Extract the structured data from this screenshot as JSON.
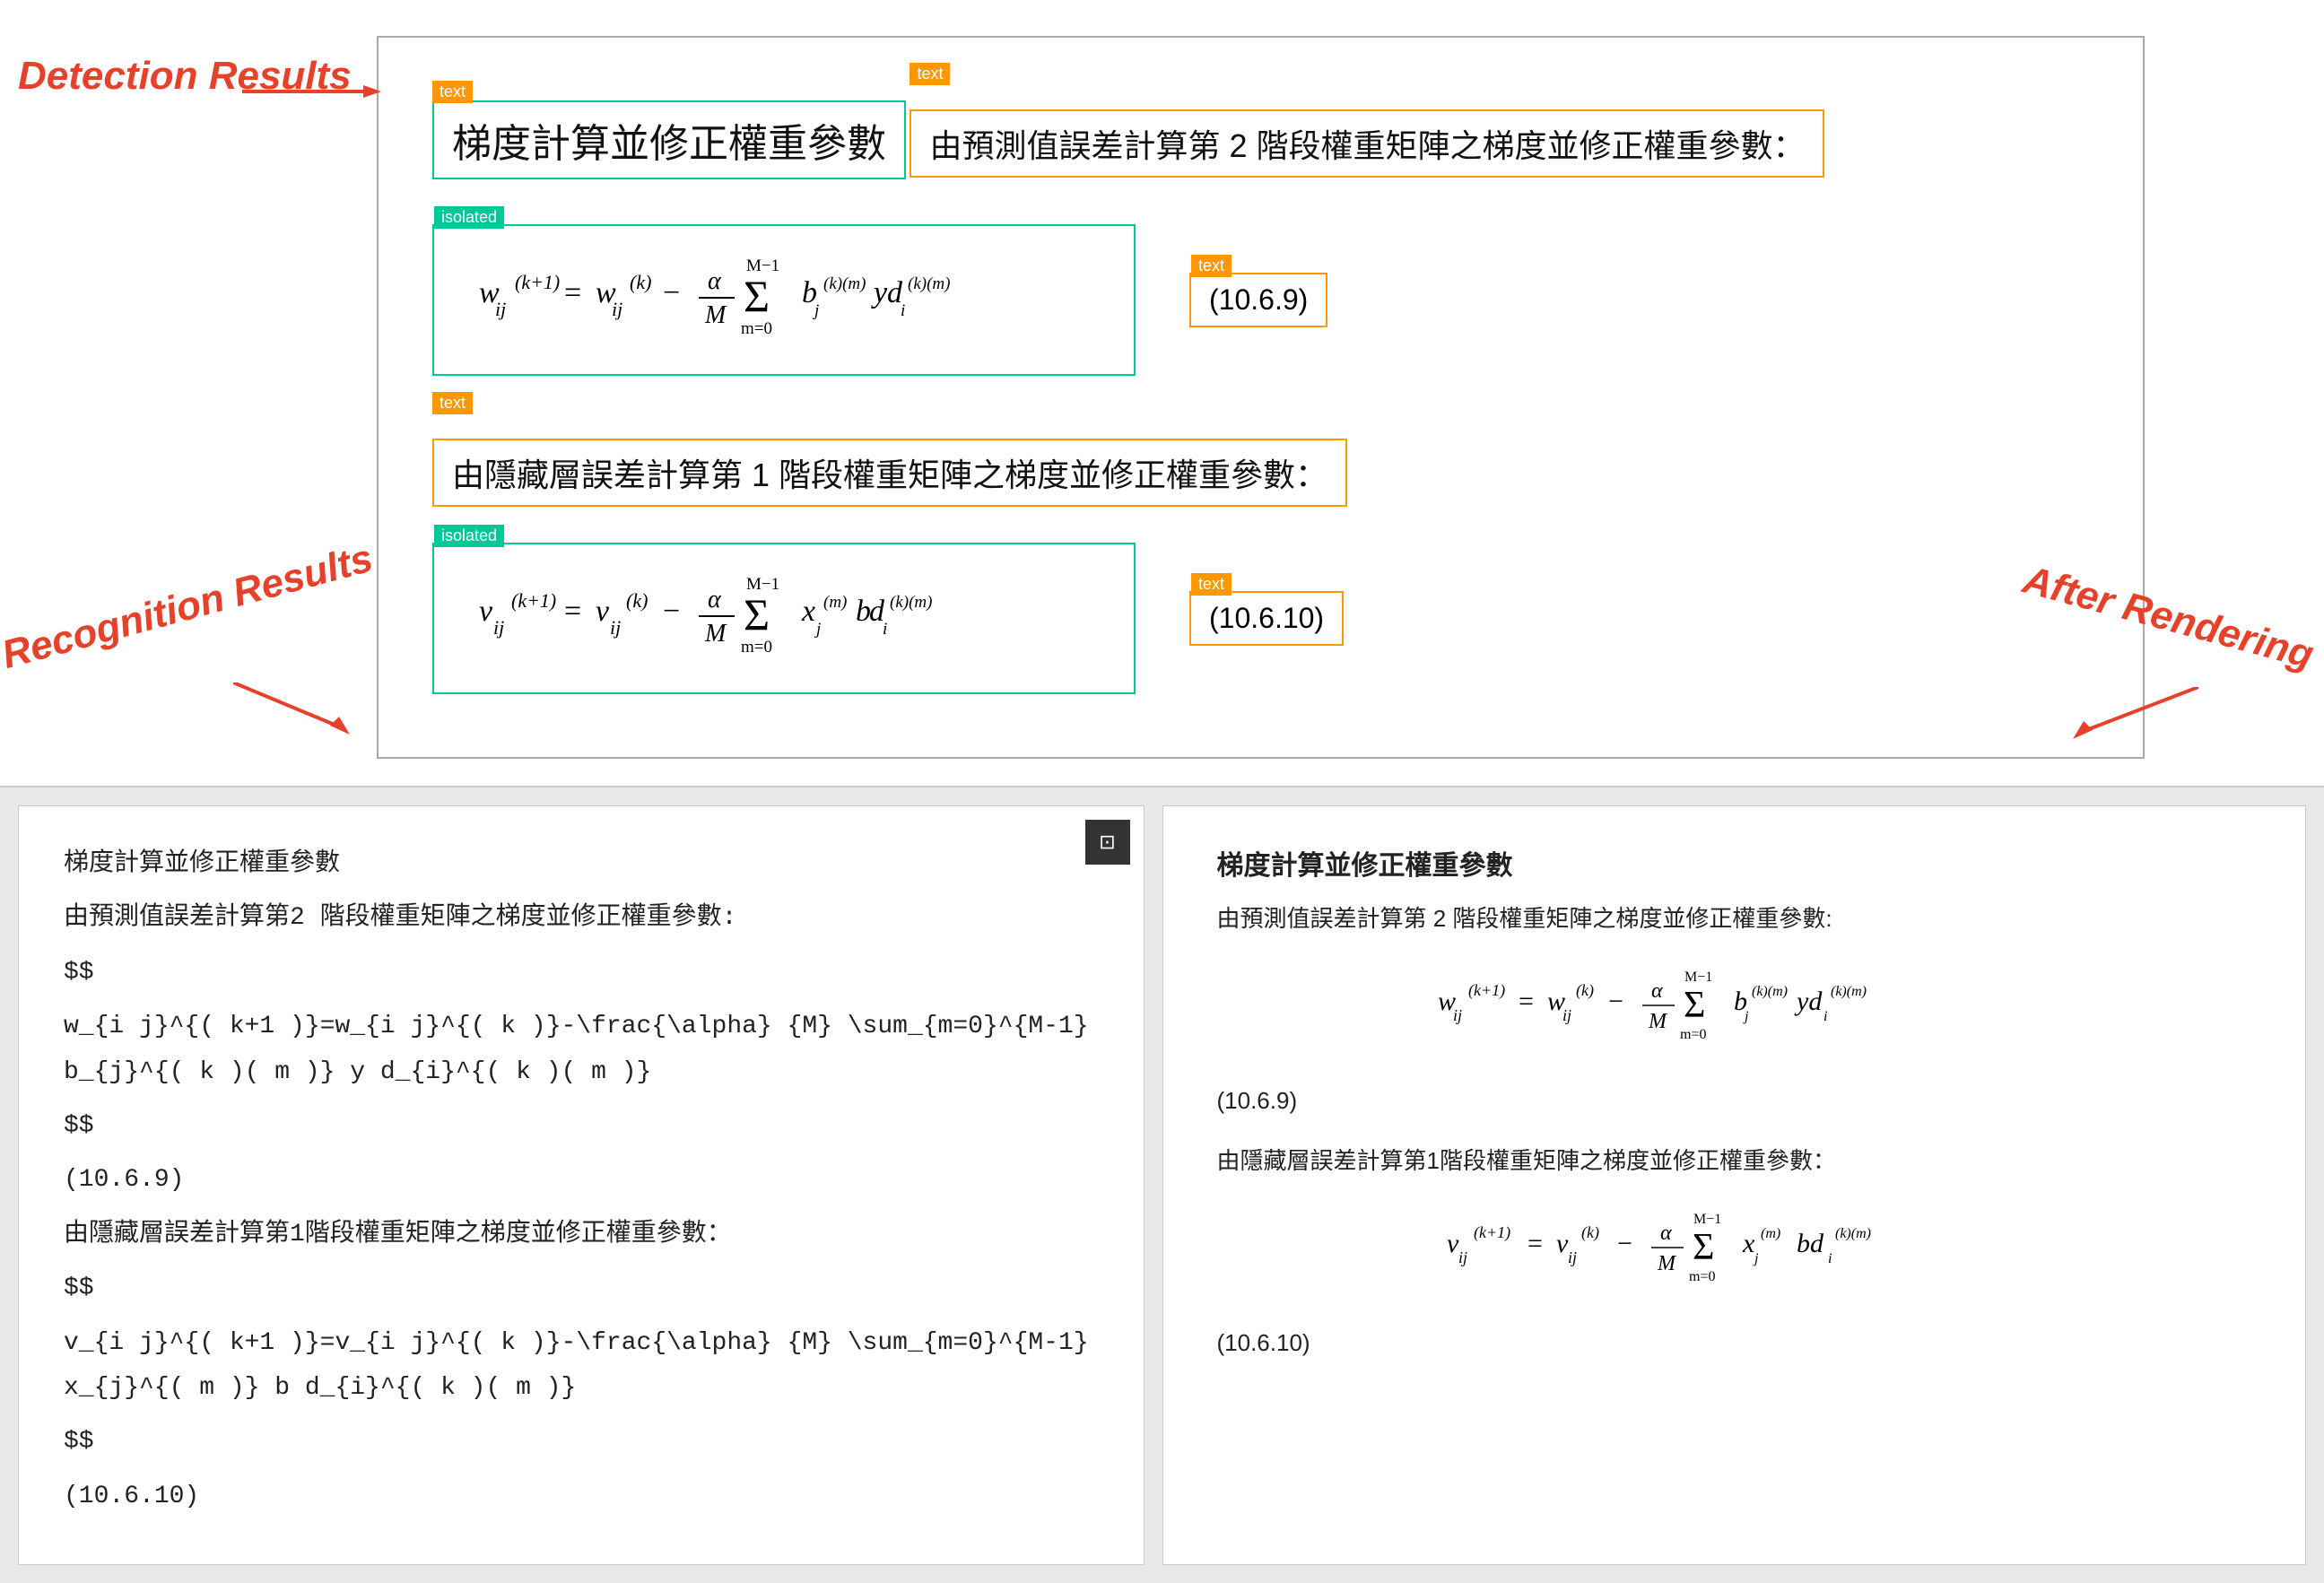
{
  "labels": {
    "detection_results": "Detection Results",
    "recognition_results": "Recognition Results",
    "after_rendering": "After Rendering"
  },
  "content": {
    "title": "梯度計算並修正權重參數",
    "title_tag": "text",
    "section1_tag": "text",
    "section1_text": "由預測值誤差計算第 2 階段權重矩陣之梯度並修正權重參數：",
    "formula1_tag": "isolated",
    "formula1_number": "(10.6.9)",
    "formula1_number_tag": "text",
    "section2_tag": "text",
    "section2_text": "由隱藏層誤差計算第 1 階段權重矩陣之梯度並修正權重參數：",
    "formula2_tag": "isolated",
    "formula2_number": "(10.6.10)",
    "formula2_number_tag": "text"
  },
  "bottom_left": {
    "copy_icon": "⊡",
    "line1": "梯度計算並修正權重參數",
    "line2": "由預測值誤差計算第2 階段權重矩陣之梯度並修正權重參數:",
    "line3": "$$",
    "line4": "w_{i j}^{( k+1 )}=w_{i j}^{( k )}-\\frac{\\alpha} {M} \\sum_{m=0}^{M-1} b_{j}^{( k )( m )} y d_{i}^{( k )( m )}",
    "line5": "$$",
    "line6": "(10.6.9)",
    "line7": "由隱藏層誤差計算第1階段權重矩陣之梯度並修正權重參數：",
    "line8": "$$",
    "line9": "v_{i j}^{( k+1 )}=v_{i j}^{( k )}-\\frac{\\alpha} {M} \\sum_{m=0}^{M-1} x_{j}^{( m )} b d_{i}^{( k )( m )}",
    "line10": "$$",
    "line11": "(10.6.10)"
  },
  "bottom_right": {
    "title": "梯度計算並修正權重參數",
    "subtitle1": "由預測值誤差計算第 2 階段權重矩陣之梯度並修正權重參數:",
    "eq1_number": "(10.6.9)",
    "subtitle2": "由隱藏層誤差計算第1階段權重矩陣之梯度並修正權重參數：",
    "eq2_number": "(10.6.10)"
  }
}
